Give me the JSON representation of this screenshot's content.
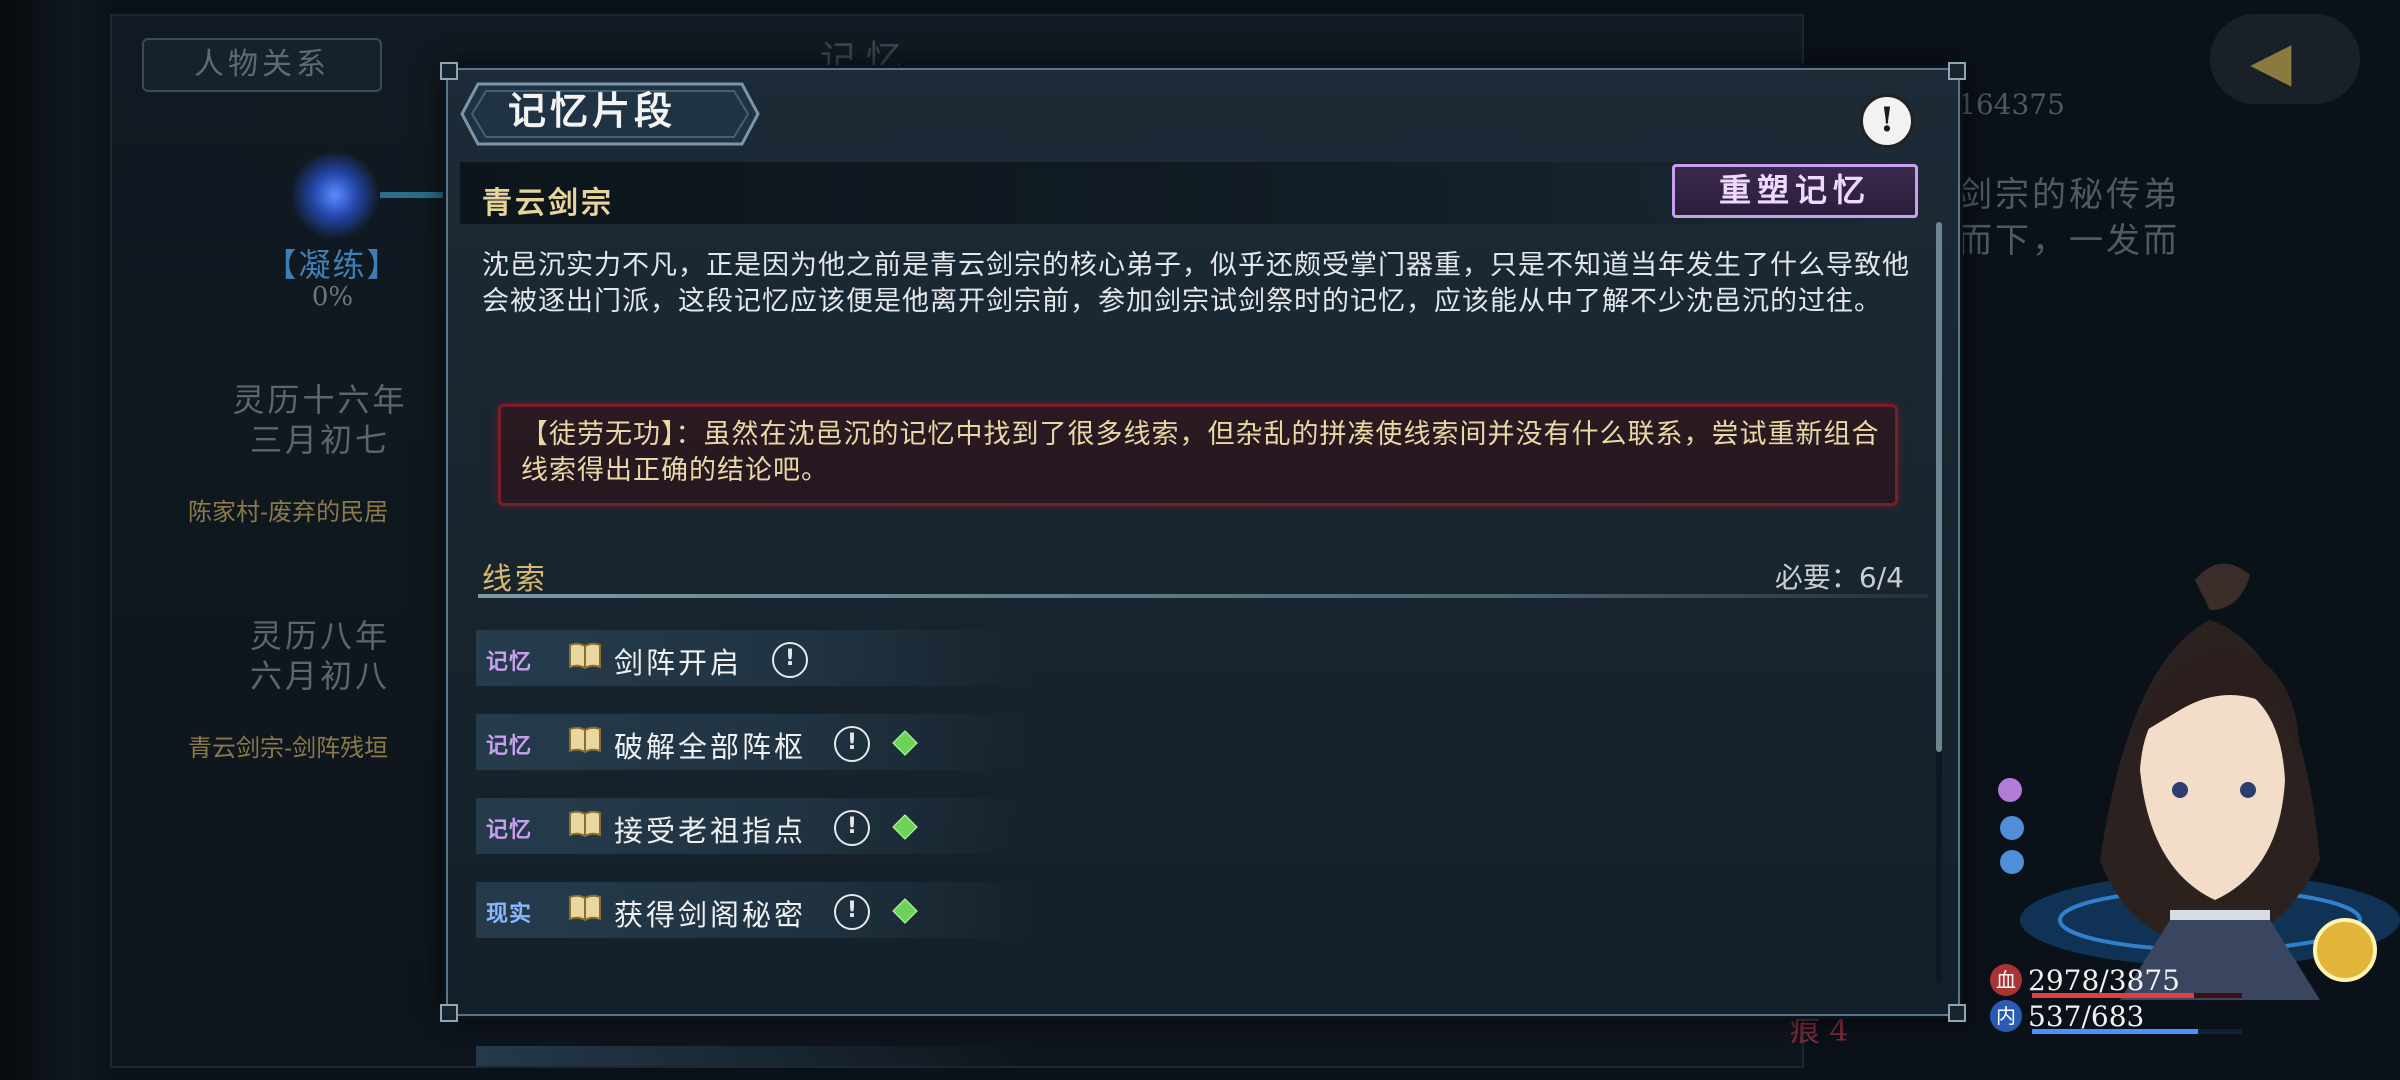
{
  "background": {
    "relation_tab": "人物关系",
    "top_title": "记忆",
    "node_status": "【凝练】",
    "node_progress": "0%",
    "entries": [
      {
        "date_line1": "灵历十六年",
        "date_line2": "三月初七",
        "place": "陈家村-废弃的民居"
      },
      {
        "date_line1": "灵历八年",
        "date_line2": "六月初八",
        "place": "青云剑宗-剑阵残垣"
      }
    ],
    "right_number": "164375",
    "right_text_line1": "剑宗的秘传弟",
    "right_text_line2": "而下，一发而",
    "bottom_text": "痕 4"
  },
  "dialog": {
    "title": "记忆片段",
    "section_title": "青云剑宗",
    "reshape_button": "重塑记忆",
    "description": "沈邑沉实力不凡，正是因为他之前是青云剑宗的核心弟子，似乎还颇受掌门器重，只是不知道当年发生了什么导致他会被逐出门派，这段记忆应该便是他离开剑宗前，参加剑宗试剑祭时的记忆，应该能从中了解不少沈邑沉的过往。",
    "warning": "【徒劳无功】：虽然在沈邑沉的记忆中找到了很多线索，但杂乱的拼凑使线索间并没有什么联系，尝试重新组合线索得出正确的结论吧。",
    "clues_title": "线索",
    "clues_required": "必要：6/4",
    "clues": [
      {
        "tag": "记忆",
        "name": "剑阵开启",
        "has_gem": false
      },
      {
        "tag": "记忆",
        "name": "破解全部阵枢",
        "has_gem": true
      },
      {
        "tag": "记忆",
        "name": "接受老祖指点",
        "has_gem": true
      },
      {
        "tag": "现实",
        "name": "获得剑阁秘密",
        "has_gem": true
      }
    ]
  },
  "hud": {
    "hp": "2978/3875",
    "mp": "537/683",
    "hp_icon": "血",
    "mp_icon": "内",
    "hp_fraction": 0.77,
    "mp_fraction": 0.79
  },
  "colors": {
    "memory_tag": "#c9a0f0",
    "reality_tag": "#8ab8ff",
    "gem": "#6cd25a",
    "warning_border": "#7a1f2a",
    "reshape_border": "#c7a0f0"
  }
}
